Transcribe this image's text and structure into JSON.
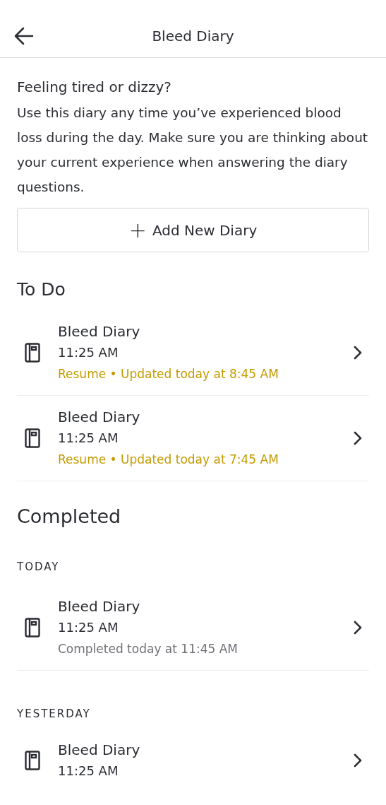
{
  "header": {
    "title": "Bleed Diary"
  },
  "intro": {
    "heading": "Feeling tired or dizzy?",
    "body": "Use this diary any time you’ve experienced blood loss during the day. Make sure you are thinking about your current experience when answering the diary questions."
  },
  "add_button": {
    "icon": "+",
    "label": "Add New Diary"
  },
  "todo": {
    "title": "To Do",
    "items": [
      {
        "title": "Bleed Diary",
        "time": "11:25 AM",
        "status": "Resume • Updated today at 8:45 AM",
        "kind": "resume"
      },
      {
        "title": "Bleed Diary",
        "time": "11:25 AM",
        "status": "Resume • Updated today at 7:45 AM",
        "kind": "resume"
      }
    ]
  },
  "completed": {
    "title": "Completed",
    "groups": [
      {
        "label": "TODAY",
        "items": [
          {
            "title": "Bleed Diary",
            "time": "11:25 AM",
            "status": "Completed today at 11:45 AM",
            "kind": "completed"
          }
        ]
      },
      {
        "label": "YESTERDAY",
        "items": [
          {
            "title": "Bleed Diary",
            "time": "11:25 AM"
          }
        ]
      }
    ]
  }
}
